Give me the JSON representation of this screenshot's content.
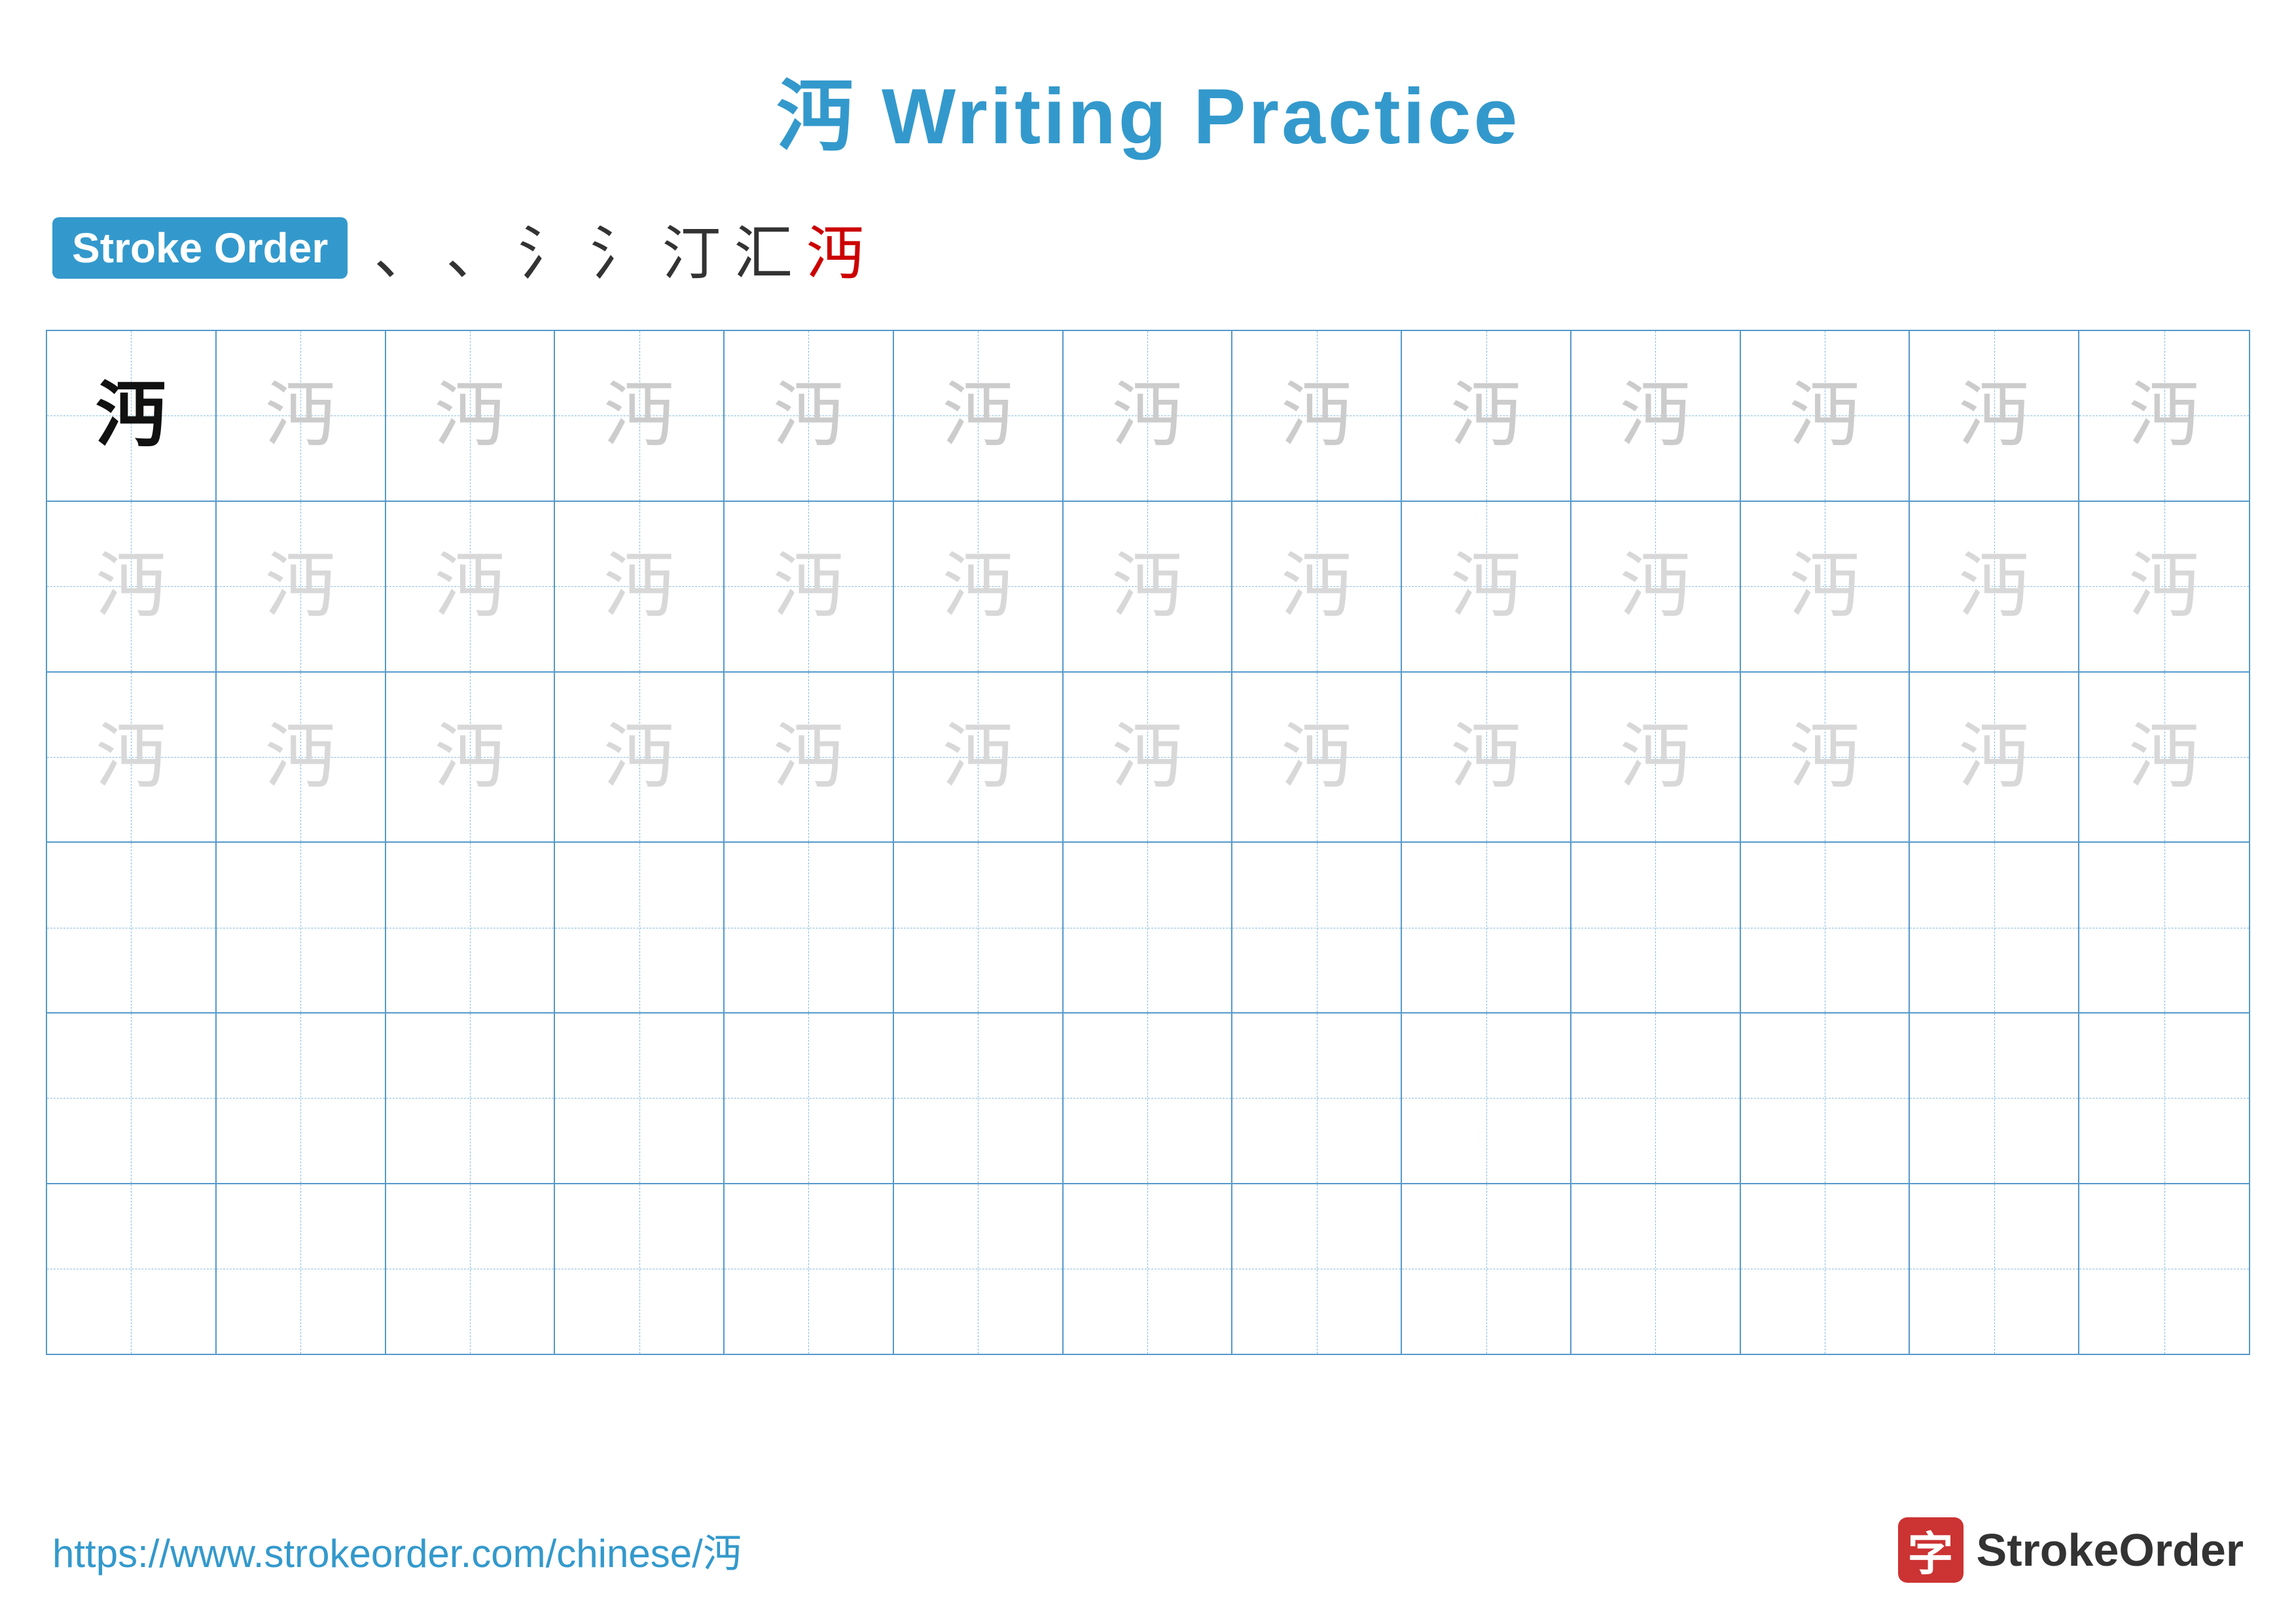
{
  "title": {
    "text": "沔 Writing Practice",
    "color": "#3399cc"
  },
  "stroke_order": {
    "badge_label": "Stroke Order",
    "strokes": [
      "、",
      "、",
      "氵",
      "氵",
      "汀",
      "汇",
      "沔"
    ]
  },
  "grid": {
    "rows": 6,
    "cols": 13,
    "character": "沔",
    "row_types": [
      "solid-then-faint1",
      "faint2",
      "faint2",
      "empty",
      "empty",
      "empty"
    ]
  },
  "footer": {
    "url": "https://www.strokeorder.com/chinese/沔",
    "logo_text": "StrokeOrder",
    "logo_char": "字"
  }
}
